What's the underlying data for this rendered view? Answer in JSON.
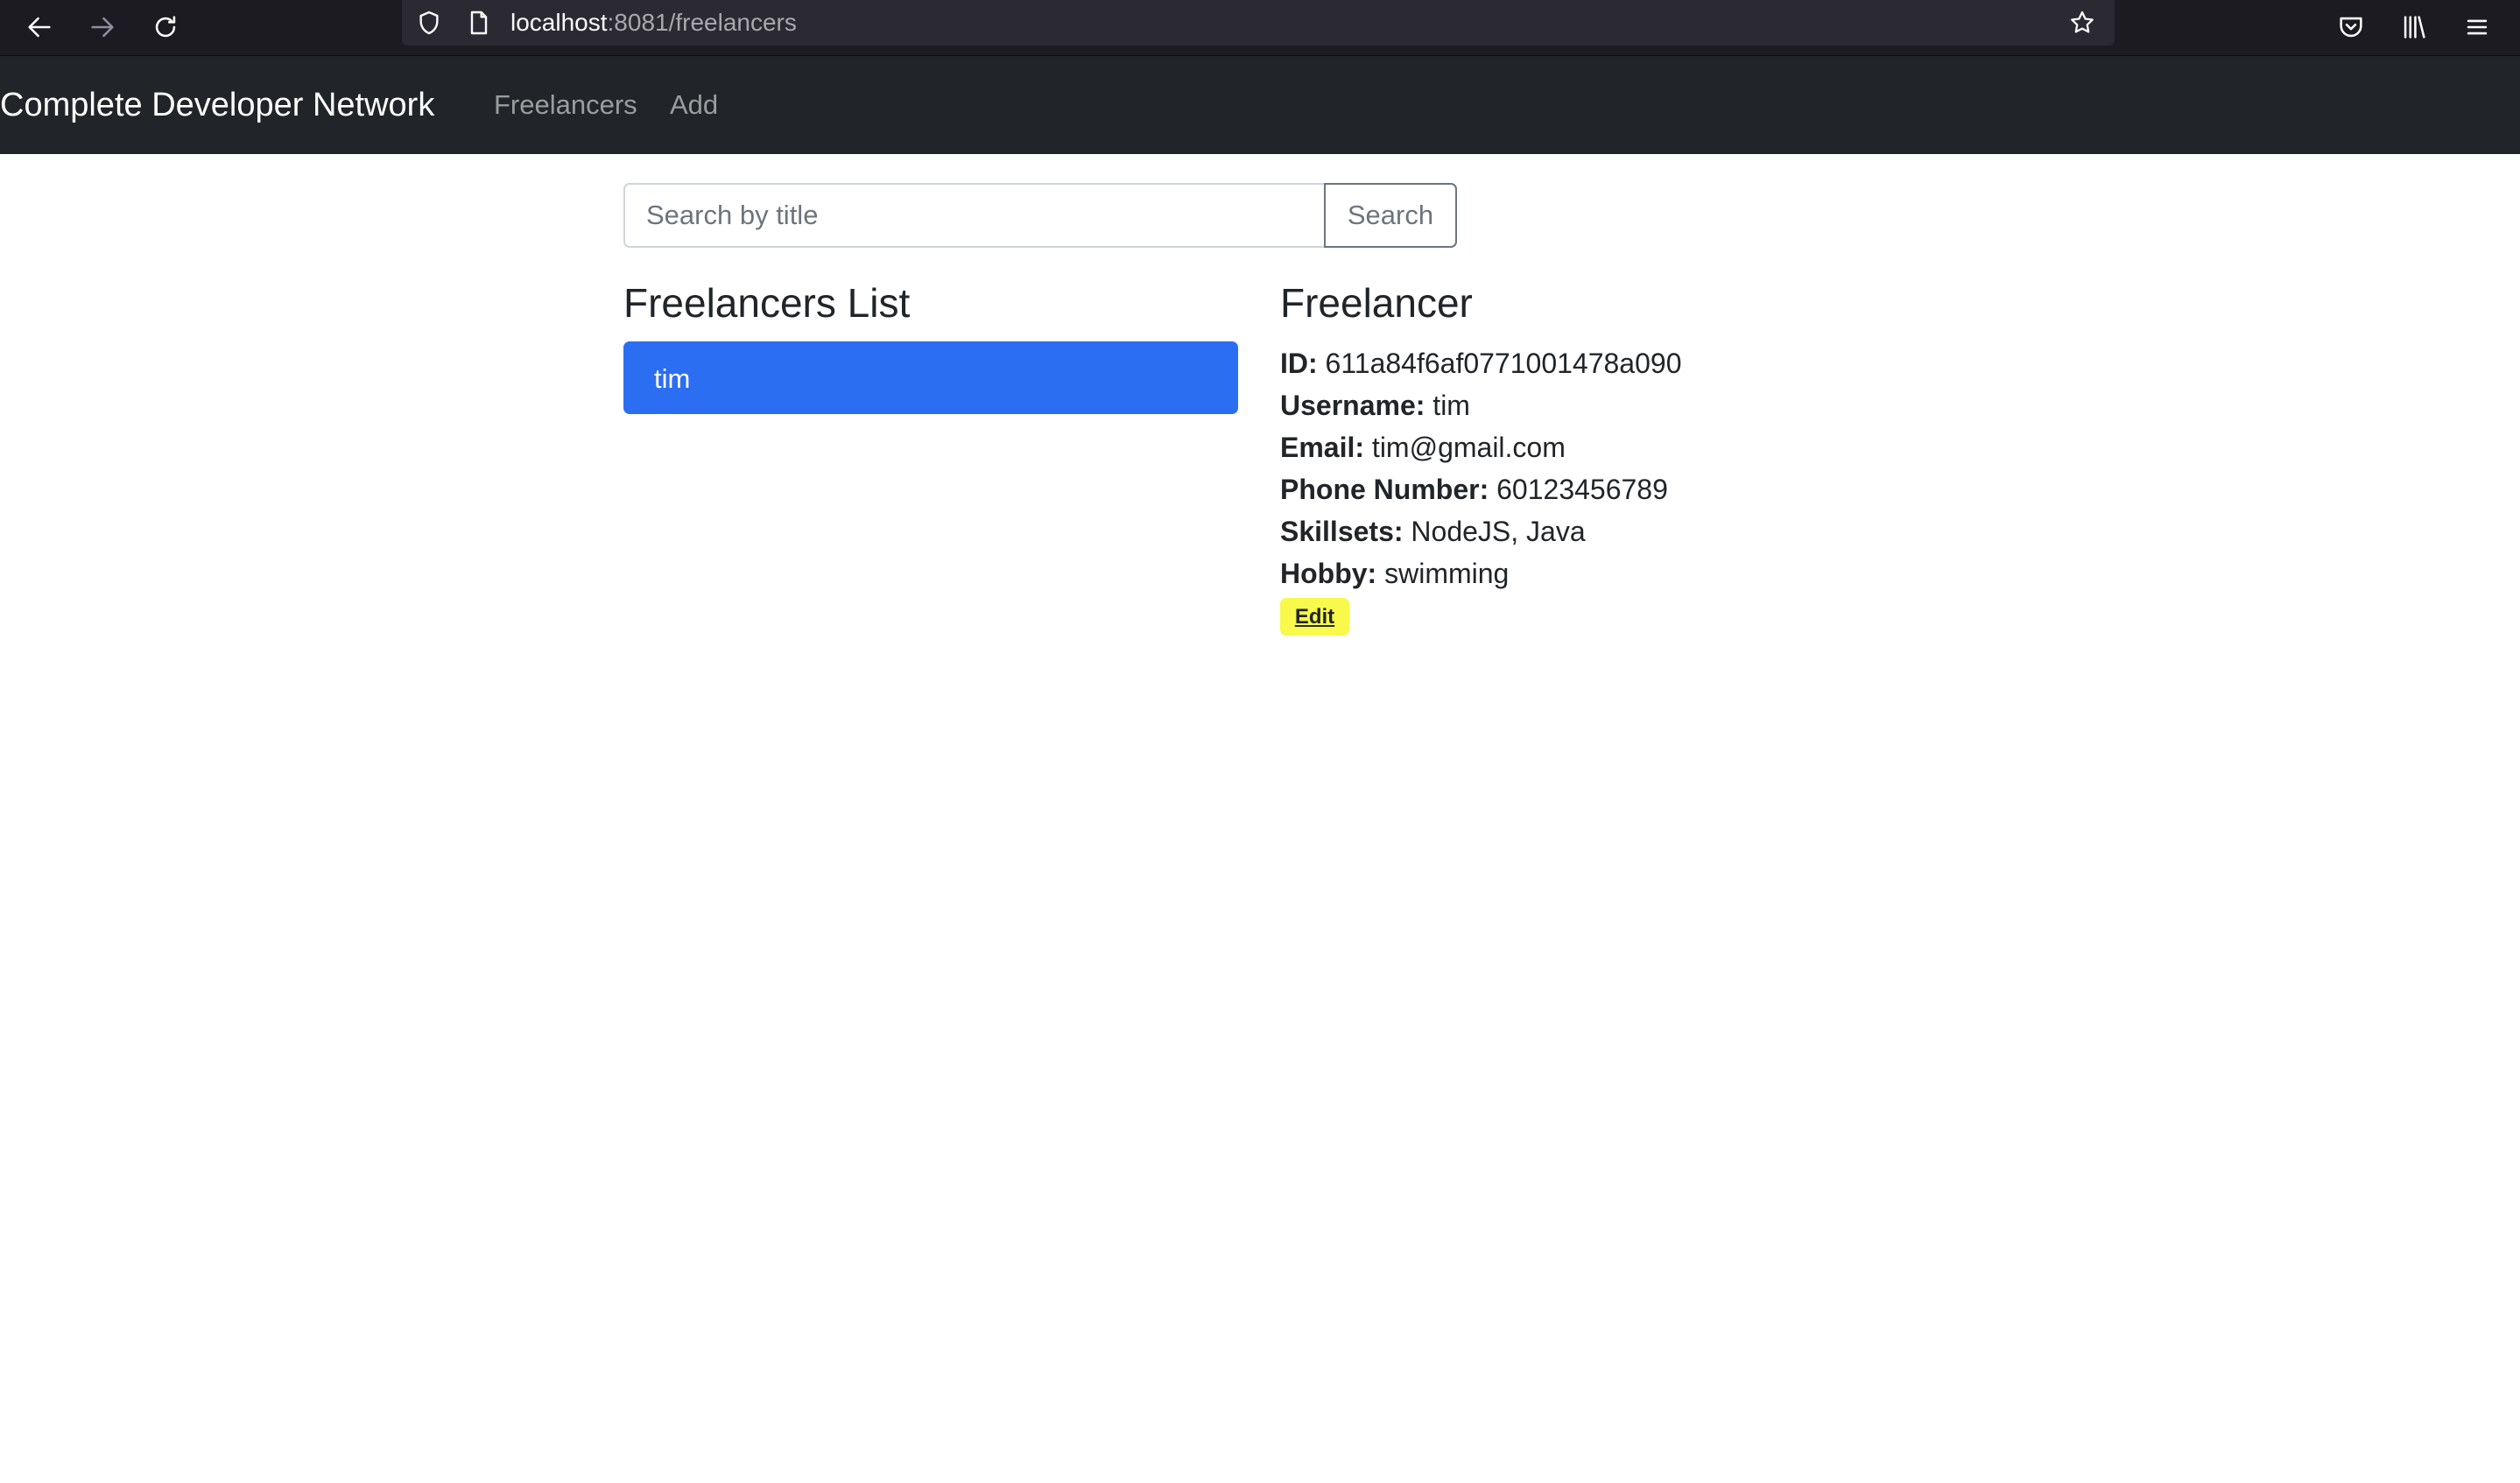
{
  "browser": {
    "url_host": "localhost",
    "url_path": ":8081/freelancers",
    "icons": {
      "back": "arrow-left-icon",
      "forward": "arrow-right-icon",
      "reload": "reload-icon",
      "tracking": "shield-icon",
      "page": "page-icon",
      "bookmark": "star-icon",
      "pocket": "pocket-icon",
      "library": "library-icon",
      "menu": "hamburger-menu-icon"
    }
  },
  "navbar": {
    "brand": "Complete Developer Network",
    "links": [
      "Freelancers",
      "Add"
    ],
    "background": "#212529"
  },
  "search": {
    "placeholder": "Search by title",
    "value": "",
    "button_label": "Search"
  },
  "list": {
    "title": "Freelancers List",
    "items": [
      {
        "label": "tim",
        "active": true
      }
    ],
    "active_color": "#2b6ef2"
  },
  "detail": {
    "title": "Freelancer",
    "fields": [
      {
        "label": "ID:",
        "value": "611a84f6af0771001478a090"
      },
      {
        "label": "Username:",
        "value": "tim"
      },
      {
        "label": "Email:",
        "value": "tim@gmail.com"
      },
      {
        "label": "Phone Number:",
        "value": "60123456789"
      },
      {
        "label": "Skillsets:",
        "value": "NodeJS, Java"
      },
      {
        "label": "Hobby:",
        "value": "swimming"
      }
    ],
    "edit_label": "Edit",
    "edit_color": "#f8f94a"
  }
}
